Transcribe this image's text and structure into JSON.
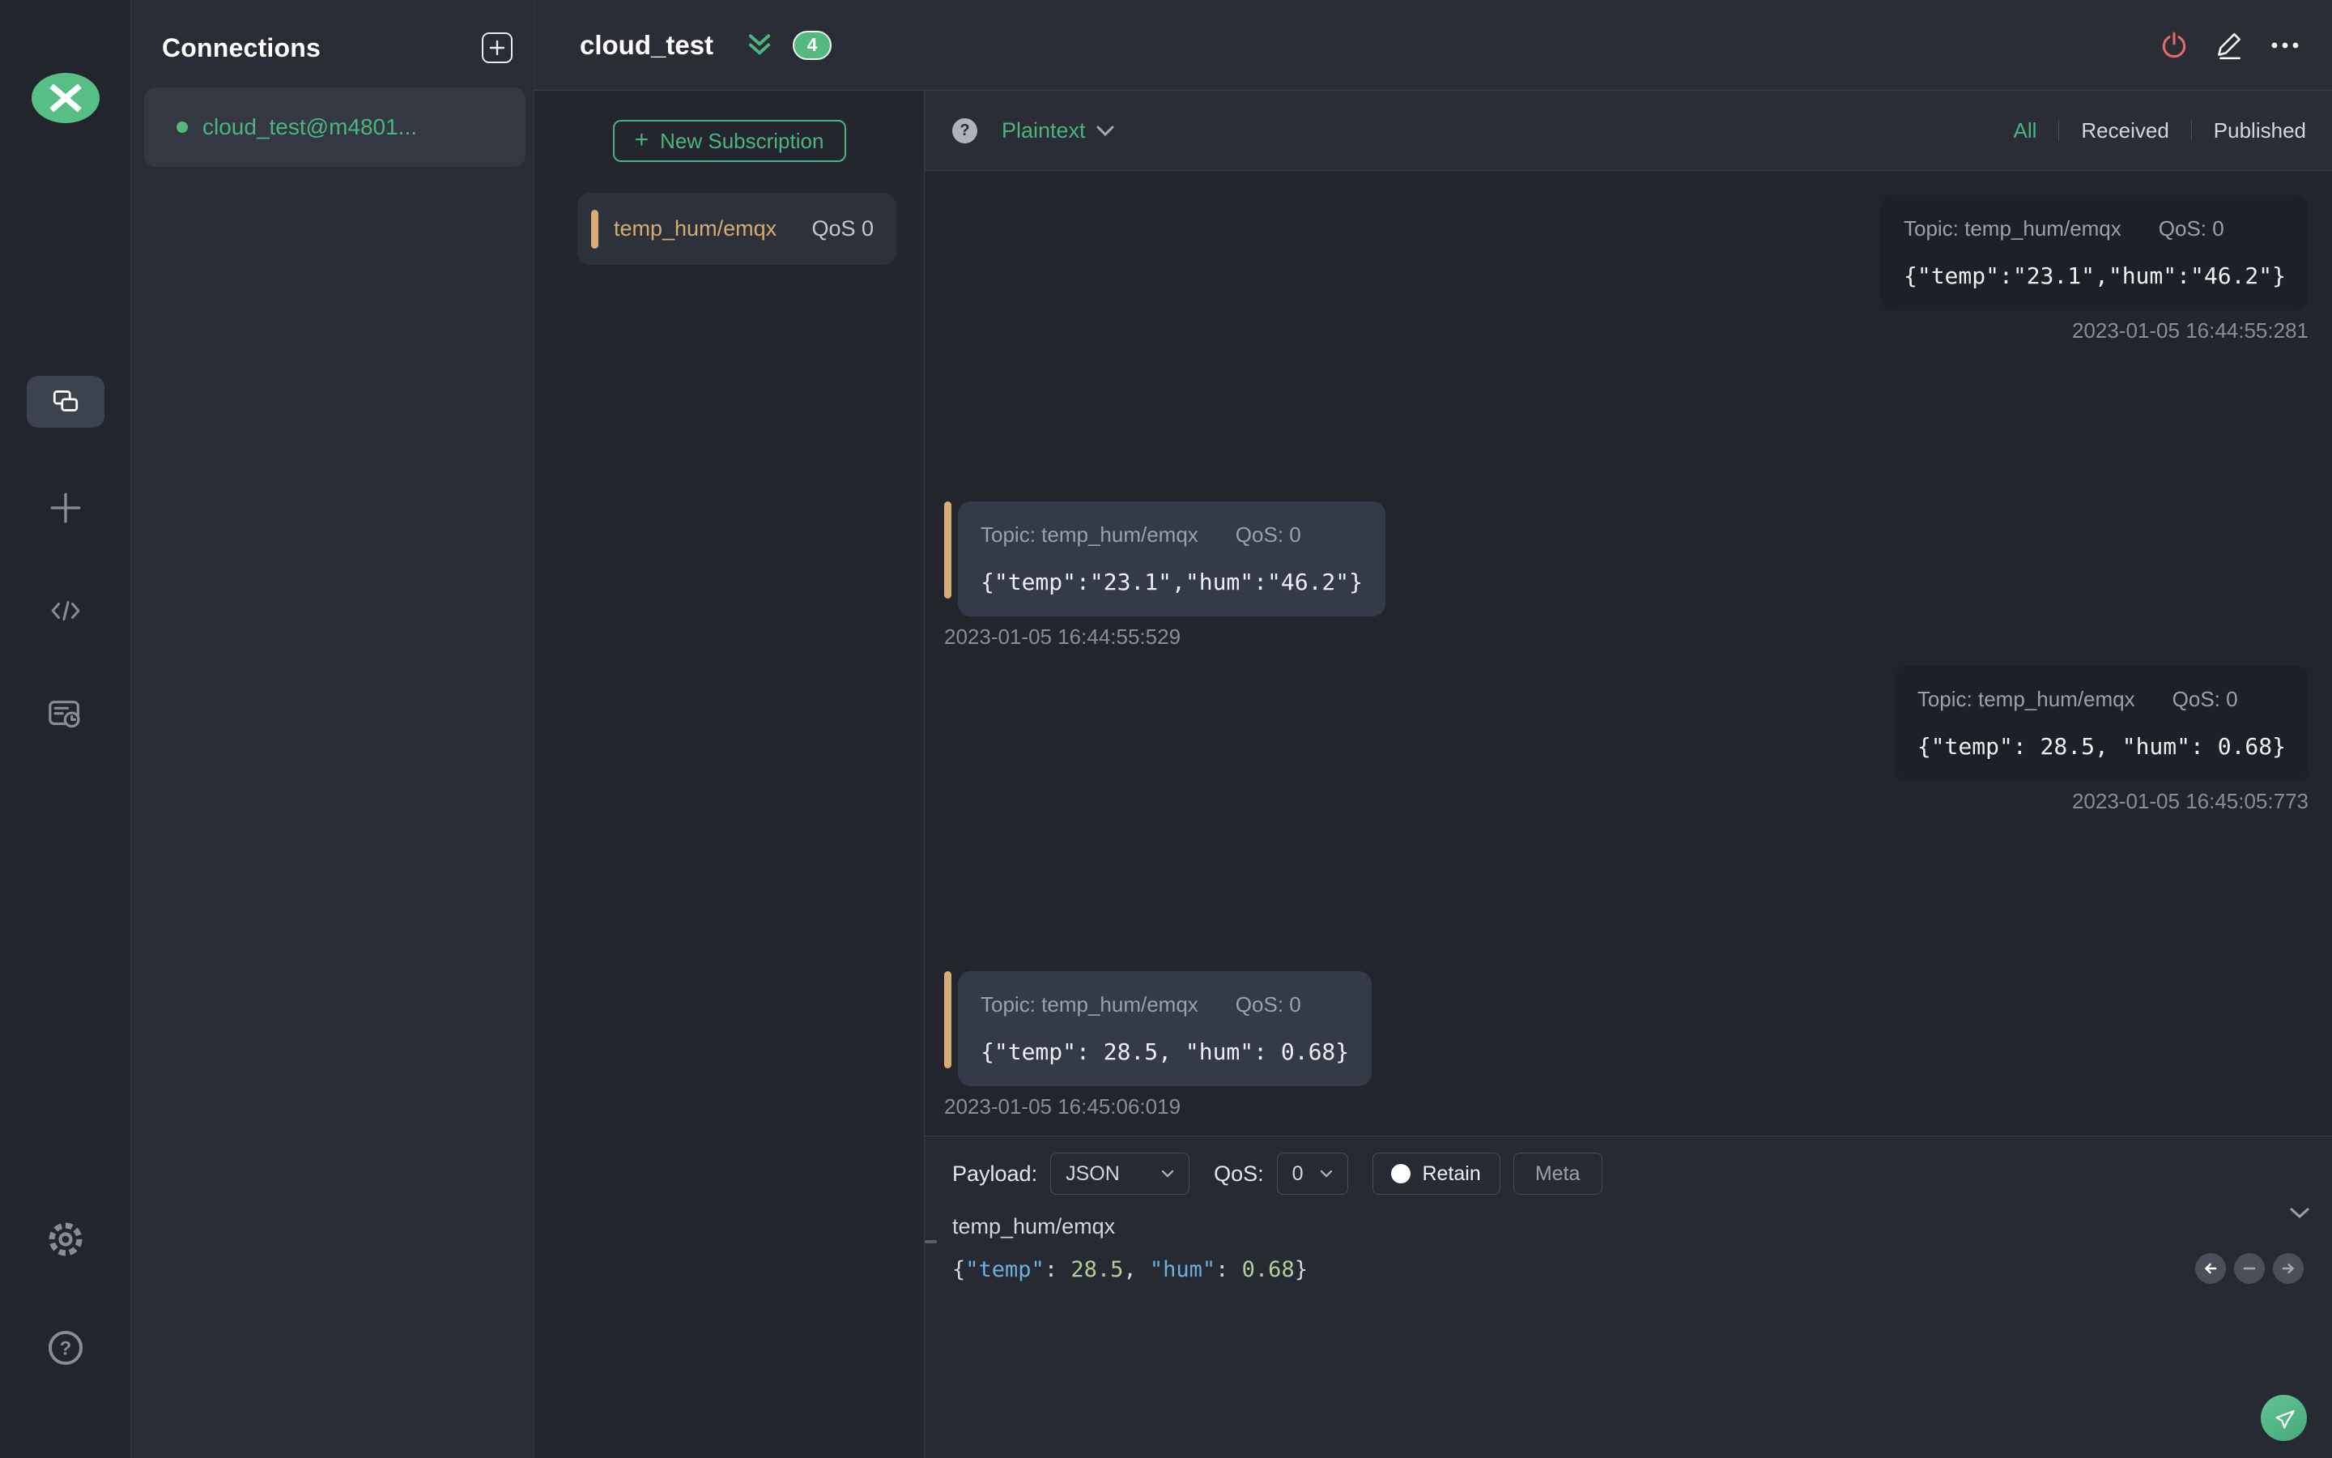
{
  "colors": {
    "accent_green": "#4cb382",
    "badge_green": "#55b87e",
    "subscription_tan": "#d8ab77",
    "danger_red": "#e0696a",
    "code_key_blue": "#72aedb",
    "code_number_green": "#b3cc9a"
  },
  "sidebar": {
    "icons": [
      "mqttx-logo",
      "connections",
      "new-connection",
      "script",
      "log",
      "settings",
      "help"
    ]
  },
  "connections": {
    "title": "Connections",
    "items": [
      {
        "name": "cloud_test@m4801...",
        "online": true
      }
    ]
  },
  "header": {
    "title": "cloud_test",
    "badge_count": "4"
  },
  "subscriptions": {
    "new_button_label": "New Subscription",
    "items": [
      {
        "topic": "temp_hum/emqx",
        "qos": "QoS 0"
      }
    ]
  },
  "messages": {
    "format_label": "Plaintext",
    "filters": {
      "all": "All",
      "received": "Received",
      "published": "Published",
      "active": "All"
    },
    "items": [
      {
        "direction": "published",
        "topic_label": "Topic: temp_hum/emqx",
        "qos_label": "QoS: 0",
        "payload": "{\"temp\":\"23.1\",\"hum\":\"46.2\"}",
        "timestamp": "2023-01-05 16:44:55:281"
      },
      {
        "direction": "received",
        "topic_label": "Topic: temp_hum/emqx",
        "qos_label": "QoS: 0",
        "payload": "{\"temp\":\"23.1\",\"hum\":\"46.2\"}",
        "timestamp": "2023-01-05 16:44:55:529"
      },
      {
        "direction": "published",
        "topic_label": "Topic: temp_hum/emqx",
        "qos_label": "QoS: 0",
        "payload": "{\"temp\": 28.5, \"hum\": 0.68}",
        "timestamp": "2023-01-05 16:45:05:773"
      },
      {
        "direction": "received",
        "topic_label": "Topic: temp_hum/emqx",
        "qos_label": "QoS: 0",
        "payload": "{\"temp\": 28.5, \"hum\": 0.68}",
        "timestamp": "2023-01-05 16:45:06:019"
      }
    ]
  },
  "publish": {
    "payload_label": "Payload:",
    "payload_format": "JSON",
    "qos_label": "QoS:",
    "qos_value": "0",
    "retain_label": "Retain",
    "meta_label": "Meta",
    "topic_value": "temp_hum/emqx",
    "payload_value": "{\"temp\": 28.5, \"hum\": 0.68}",
    "payload_tokens": [
      {
        "t": "{"
      },
      {
        "t": "\"temp\""
      },
      {
        "t": ": "
      },
      {
        "t": "28.5"
      },
      {
        "t": ", "
      },
      {
        "t": "\"hum\""
      },
      {
        "t": ": "
      },
      {
        "t": "0.68"
      },
      {
        "t": "}"
      }
    ]
  }
}
